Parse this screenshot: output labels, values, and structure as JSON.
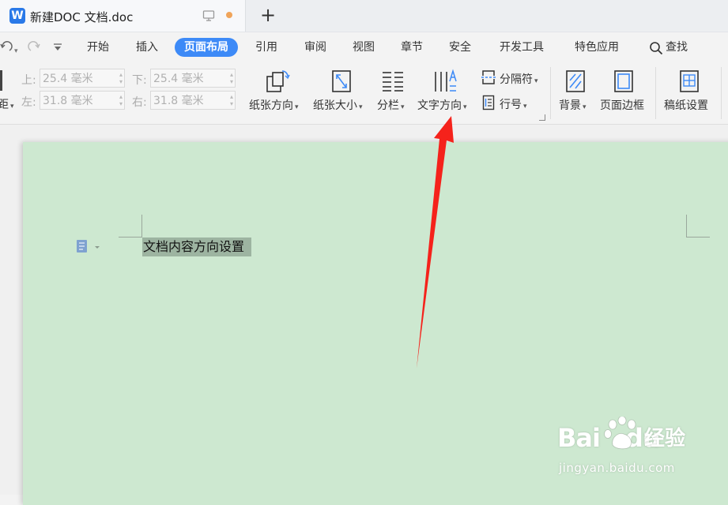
{
  "titlebar": {
    "app_icon_letter": "W",
    "doc_title": "新建DOC 文档.doc",
    "new_tab_symbol": "+"
  },
  "menubar": {
    "tabs": [
      {
        "label": "开始"
      },
      {
        "label": "插入"
      },
      {
        "label": "页面布局",
        "active": true
      },
      {
        "label": "引用"
      },
      {
        "label": "审阅"
      },
      {
        "label": "视图"
      },
      {
        "label": "章节"
      },
      {
        "label": "安全"
      },
      {
        "label": "开发工具"
      },
      {
        "label": "特色应用"
      }
    ],
    "search_label": "查找"
  },
  "ribbon": {
    "margins_partial_label": "距",
    "margin_top_label": "上:",
    "margin_top_value": "25.4 毫米",
    "margin_bottom_label": "下:",
    "margin_bottom_value": "25.4 毫米",
    "margin_left_label": "左:",
    "margin_left_value": "31.8 毫米",
    "margin_right_label": "右:",
    "margin_right_value": "31.8 毫米",
    "orientation_label": "纸张方向",
    "paper_size_label": "纸张大小",
    "columns_label": "分栏",
    "text_direction_label": "文字方向",
    "separator_label": "分隔符",
    "line_number_label": "行号",
    "background_label": "背景",
    "page_border_label": "页面边框",
    "manuscript_label": "稿纸设置"
  },
  "document": {
    "selected_text": "文档内容方向设置"
  },
  "watermark": {
    "logo": "Bai",
    "logo_du": "du",
    "logo_cn": "经验",
    "url": "jingyan.baidu.com"
  },
  "colors": {
    "accent": "#3d8af7",
    "page_background": "#cde8d0",
    "selection": "#9db4a1",
    "annotation_arrow": "#f5221b"
  }
}
